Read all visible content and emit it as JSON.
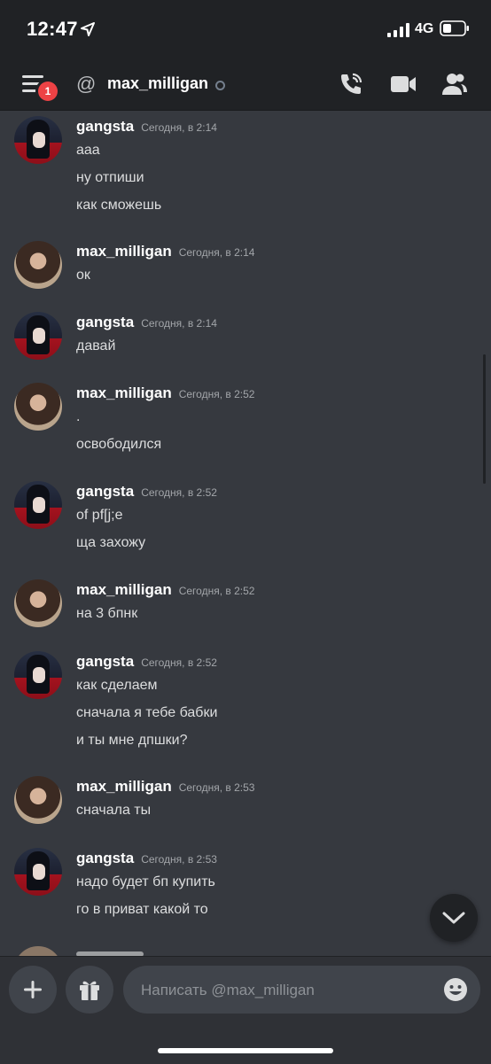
{
  "status_bar": {
    "time": "12:47",
    "network": "4G"
  },
  "header": {
    "badge_count": "1",
    "at_symbol": "@",
    "channel_name": "max_milligan"
  },
  "messages": [
    {
      "author": "gangsta",
      "time": "Сегодня, в 2:14",
      "avatar": "gangsta-avatar",
      "lines": [
        "ааа",
        "ну отпиши",
        "как сможешь"
      ]
    },
    {
      "author": "max_milligan",
      "time": "Сегодня, в 2:14",
      "avatar": "max-avatar",
      "lines": [
        "ок"
      ]
    },
    {
      "author": "gangsta",
      "time": "Сегодня, в 2:14",
      "avatar": "gangsta-avatar",
      "lines": [
        "давай"
      ]
    },
    {
      "author": "max_milligan",
      "time": "Сегодня, в 2:52",
      "avatar": "max-avatar",
      "lines": [
        ".",
        "освободился"
      ]
    },
    {
      "author": "gangsta",
      "time": "Сегодня, в 2:52",
      "avatar": "gangsta-avatar",
      "lines": [
        "of pf[j;e",
        "ща захожу"
      ]
    },
    {
      "author": "max_milligan",
      "time": "Сегодня, в 2:52",
      "avatar": "max-avatar",
      "lines": [
        "на 3 бпнк"
      ]
    },
    {
      "author": "gangsta",
      "time": "Сегодня, в 2:52",
      "avatar": "gangsta-avatar",
      "lines": [
        "как сделаем",
        "сначала я тебе бабки",
        "и ты мне дпшки?"
      ]
    },
    {
      "author": "max_milligan",
      "time": "Сегодня, в 2:53",
      "avatar": "max-avatar",
      "lines": [
        "сначала ты"
      ]
    },
    {
      "author": "gangsta",
      "time": "Сегодня, в 2:53",
      "avatar": "gangsta-avatar",
      "lines": [
        "надо будет бп купить",
        "го в приват какой то"
      ]
    }
  ],
  "composer": {
    "placeholder": "Написать @max_milligan"
  },
  "icons": {
    "location_arrow": "location-arrow-icon",
    "signal": "signal-bars-icon",
    "battery": "battery-icon",
    "menu": "hamburger-menu-icon",
    "call": "phone-call-icon",
    "video": "video-camera-icon",
    "members": "members-icon",
    "jump": "chevron-down-icon",
    "plus": "plus-icon",
    "gift": "gift-icon",
    "emoji": "emoji-icon"
  },
  "colors": {
    "background": "#36393f",
    "header": "#202225",
    "badge": "#ed4245",
    "input": "#40444b"
  }
}
